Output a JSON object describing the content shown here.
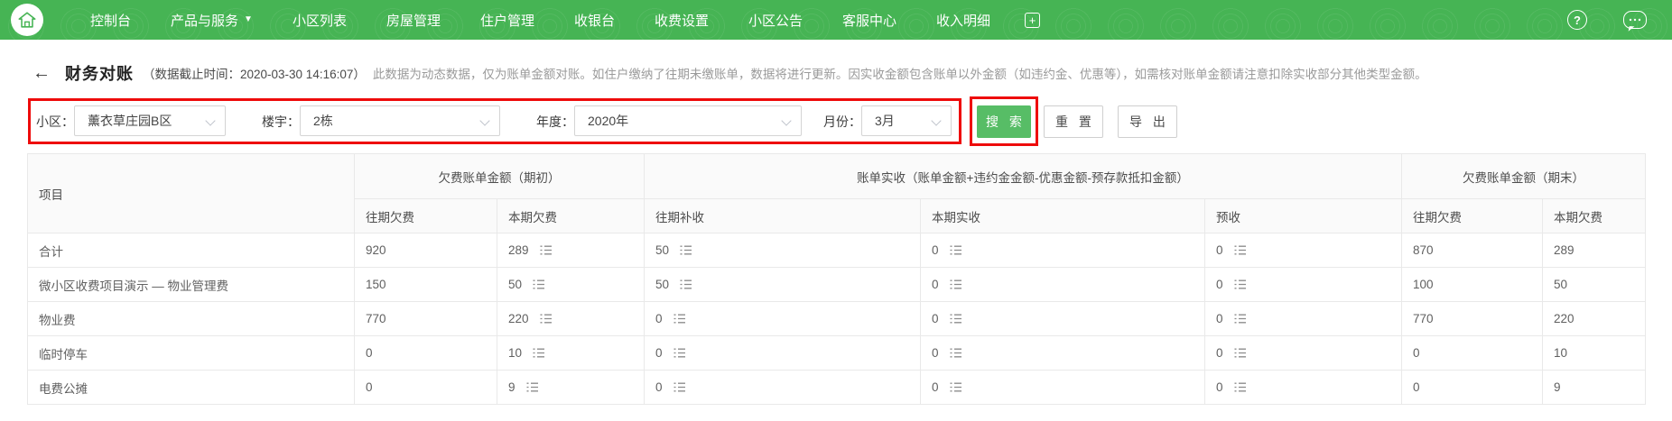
{
  "nav": {
    "items": [
      {
        "label": "控制台"
      },
      {
        "label": "产品与服务"
      },
      {
        "label": "小区列表"
      },
      {
        "label": "房屋管理"
      },
      {
        "label": "住户管理"
      },
      {
        "label": "收银台"
      },
      {
        "label": "收费设置"
      },
      {
        "label": "小区公告"
      },
      {
        "label": "客服中心"
      },
      {
        "label": "收入明细"
      }
    ],
    "icons": {
      "caret_down": "▼",
      "plus": "+",
      "help": "?",
      "chat_dots": "•••"
    }
  },
  "page_header": {
    "back_arrow": "←",
    "title": "财务对账",
    "subtitle": "（数据截止时间：2020-03-30 14:16:07）",
    "note": "此数据为动态数据，仅为账单金额对账。如住户缴纳了往期未缴账单，数据将进行更新。因实收金额包含账单以外金额（如违约金、优惠等），如需核对账单金额请注意扣除实收部分其他类型金额。"
  },
  "filters": {
    "community": {
      "label": "小区：",
      "value": "薰衣草庄园B区"
    },
    "building": {
      "label": "楼宇：",
      "value": "2栋"
    },
    "year": {
      "label": "年度：",
      "value": "2020年"
    },
    "month": {
      "label": "月份：",
      "value": "3月"
    }
  },
  "actions": {
    "search": "搜 索",
    "reset": "重 置",
    "export": "导 出"
  },
  "table": {
    "col_project": "项目",
    "groups": [
      "欠费账单金额（期初）",
      "账单实收（账单金额+违约金金额-优惠金额-预存款抵扣金额）",
      "欠费账单金额（期末）"
    ],
    "sub_headers": [
      "往期欠费",
      "本期欠费",
      "往期补收",
      "本期实收",
      "预收",
      "往期欠费",
      "本期欠费"
    ],
    "rows": [
      {
        "project": "合计",
        "values": [
          "920",
          "289",
          "50",
          "0",
          "0",
          "870",
          "289"
        ]
      },
      {
        "project": "微小区收费项目演示 — 物业管理费",
        "values": [
          "150",
          "50",
          "50",
          "0",
          "0",
          "100",
          "50"
        ]
      },
      {
        "project": "物业费",
        "values": [
          "770",
          "220",
          "0",
          "0",
          "0",
          "770",
          "220"
        ]
      },
      {
        "project": "临时停车",
        "values": [
          "0",
          "10",
          "0",
          "0",
          "0",
          "0",
          "10"
        ]
      },
      {
        "project": "电费公摊",
        "values": [
          "0",
          "9",
          "0",
          "0",
          "0",
          "0",
          "9"
        ]
      }
    ]
  },
  "colors": {
    "nav_green": "#46b454",
    "search_green": "#57bd66",
    "annotation_red": "#ee0b0b",
    "table_border": "#e9e9e9"
  }
}
